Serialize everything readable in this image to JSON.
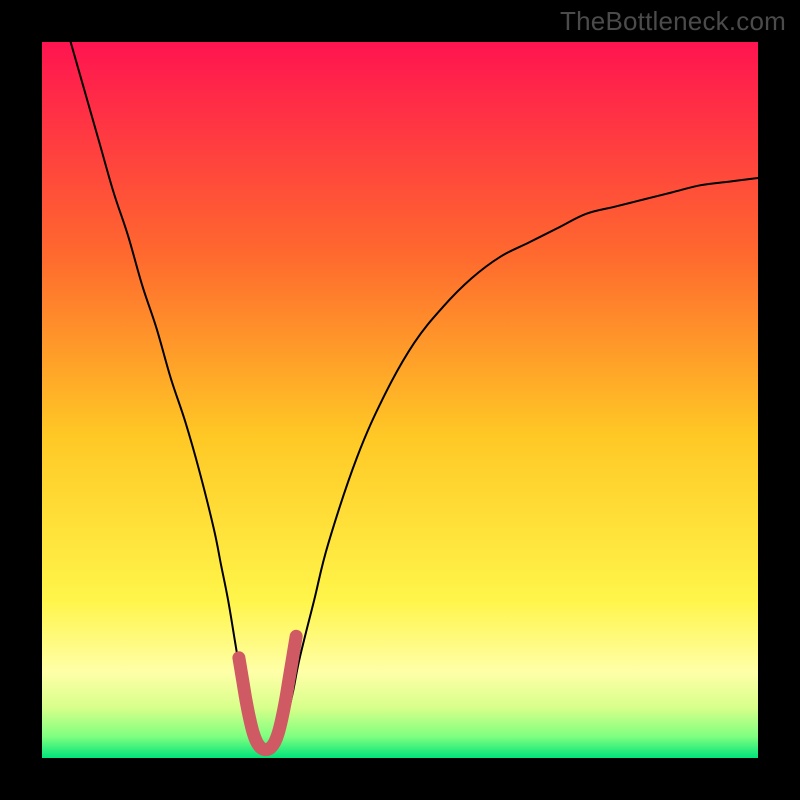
{
  "watermark": "TheBottleneck.com",
  "chart_data": {
    "type": "line",
    "title": "",
    "xlabel": "",
    "ylabel": "",
    "xlim": [
      0,
      100
    ],
    "ylim": [
      0,
      100
    ],
    "grid": false,
    "legend": false,
    "background_gradient": {
      "direction": "vertical",
      "stops": [
        {
          "offset": 0.0,
          "color": "#ff1450"
        },
        {
          "offset": 0.3,
          "color": "#ff6a2e"
        },
        {
          "offset": 0.55,
          "color": "#ffc825"
        },
        {
          "offset": 0.78,
          "color": "#fff54a"
        },
        {
          "offset": 0.88,
          "color": "#ffffa8"
        },
        {
          "offset": 0.93,
          "color": "#d7ff8a"
        },
        {
          "offset": 0.97,
          "color": "#7fff80"
        },
        {
          "offset": 1.0,
          "color": "#00e47a"
        }
      ]
    },
    "series": [
      {
        "name": "curve",
        "color": "#000000",
        "width": 2,
        "x": [
          4,
          6,
          8,
          10,
          12,
          14,
          16,
          18,
          20,
          22,
          24,
          25,
          26,
          27,
          28,
          29,
          30,
          31,
          32,
          33,
          34,
          35,
          36,
          38,
          40,
          44,
          48,
          52,
          56,
          60,
          64,
          68,
          72,
          76,
          80,
          84,
          88,
          92,
          96,
          100
        ],
        "y": [
          100,
          93,
          86,
          79,
          73,
          66,
          60,
          53,
          47,
          40,
          32,
          27,
          22,
          16,
          10,
          5,
          2,
          1,
          1,
          2,
          5,
          9,
          14,
          22,
          30,
          42,
          51,
          58,
          63,
          67,
          70,
          72,
          74,
          76,
          77,
          78,
          79,
          80,
          80.5,
          81
        ]
      },
      {
        "name": "valley-highlight",
        "color": "#cf5a63",
        "width": 13,
        "linecap": "round",
        "x": [
          27.5,
          28,
          28.5,
          29,
          29.5,
          30,
          30.5,
          31,
          31.5,
          32,
          32.5,
          33,
          33.5,
          34,
          34.5,
          35,
          35.5
        ],
        "y": [
          14,
          11,
          8,
          5.5,
          3.5,
          2.2,
          1.5,
          1.2,
          1.2,
          1.5,
          2.2,
          3.5,
          5.5,
          8,
          11,
          14,
          17
        ]
      }
    ]
  }
}
